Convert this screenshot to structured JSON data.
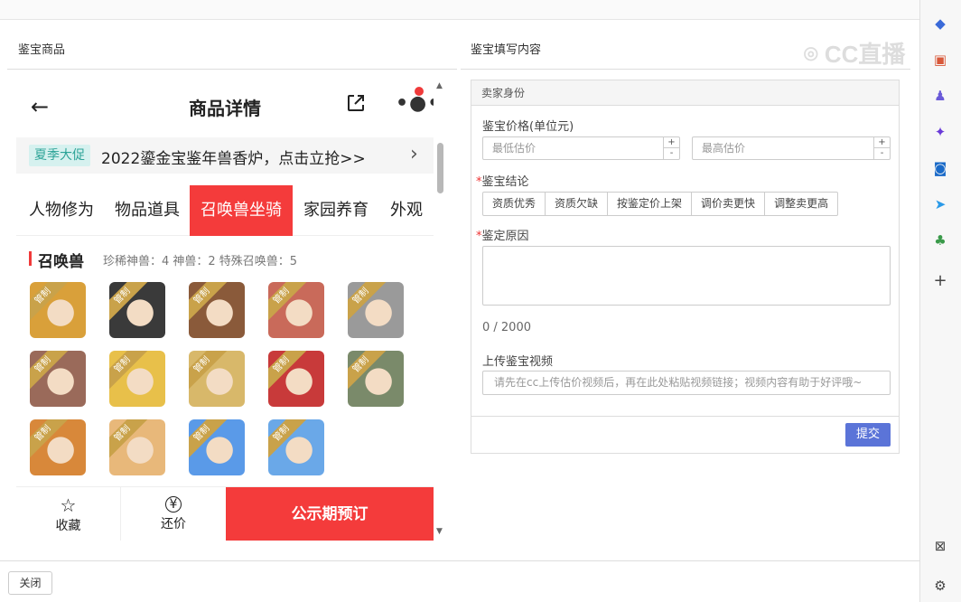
{
  "left_panel": {
    "title": "鉴宝商品"
  },
  "right_panel": {
    "title": "鉴宝填写内容"
  },
  "phone": {
    "title": "商品详情",
    "promo": {
      "badge": "夏季大促",
      "text": "2022鎏金宝鉴年兽香炉，点击立抢>>"
    },
    "tabs": [
      {
        "label": "人物修为"
      },
      {
        "label": "物品道具"
      },
      {
        "label": "召唤兽坐骑",
        "active": true
      },
      {
        "label": "家园养育"
      },
      {
        "label": "外观"
      }
    ],
    "section": {
      "title": "召唤兽",
      "stats": "珍稀神兽：4   神兽：2   特殊召唤兽：5"
    },
    "ribbon_label": "管制",
    "grid_colors": [
      "#d9a03a",
      "#3a3a3a",
      "#8a5a3a",
      "#c96a5a",
      "#9a9a9a",
      "#9a6a5a",
      "#e8c04a",
      "#d8b86a",
      "#c83a3a",
      "#7a8a6a",
      "#d8883a",
      "#e8b87a",
      "#5a9ae8",
      "#6aa8e8"
    ],
    "bottom": {
      "collect": "收藏",
      "bargain": "还价",
      "main": "公示期预订"
    }
  },
  "form": {
    "header": "卖家身份",
    "price_label": "鉴宝价格(单位元)",
    "min_placeholder": "最低估价",
    "max_placeholder": "最高估价",
    "conclusion_label": "鉴宝结论",
    "conclusions": [
      "资质优秀",
      "资质欠缺",
      "按鉴定价上架",
      "调价卖更快",
      "调整卖更高"
    ],
    "reason_label": "鉴定原因",
    "counter": "0 / 2000",
    "video_label": "上传鉴宝视频",
    "video_placeholder": "请先在cc上传估价视频后，再在此处粘贴视频链接；视频内容有助于好评哦~",
    "submit": "提交"
  },
  "close_label": "关闭",
  "watermark": "CC直播"
}
